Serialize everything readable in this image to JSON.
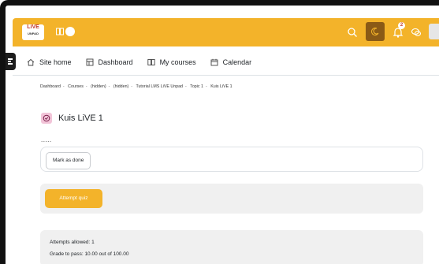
{
  "header": {
    "logo_text": "LiVE",
    "logo_sub": "UNPAD",
    "notification_count": "2"
  },
  "nav": {
    "items": [
      "Site home",
      "Dashboard",
      "My courses",
      "Calendar"
    ]
  },
  "breadcrumb": [
    "Dashboard",
    "Courses",
    "(hidden)",
    "(hidden)",
    "Tutorial LMS LiVE Unpad",
    "Topic 1",
    "Kuis LiVE 1"
  ],
  "page": {
    "title": "Kuis LiVE 1",
    "description": ".....",
    "mark_done_label": "Mark as done",
    "attempt_label": "Attempt quiz",
    "attempts_allowed": "Attempts allowed: 1",
    "grade_to_pass": "Grade to pass: 10.00 out of 100.00"
  },
  "colors": {
    "accent": "#f3b32a",
    "quiz_icon_bg": "#f2c4d8"
  }
}
